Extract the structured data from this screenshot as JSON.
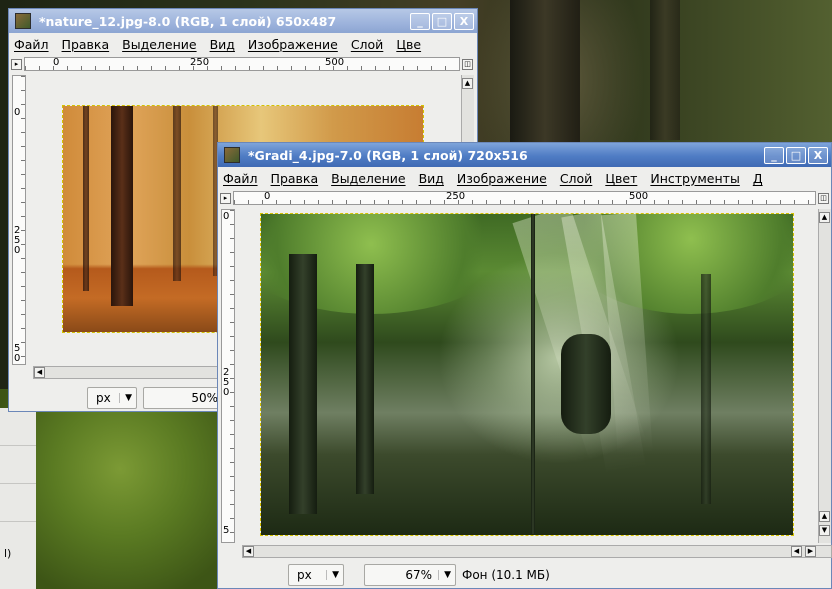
{
  "window_back": {
    "title": "*nature_12.jpg-8.0 (RGB, 1 слой) 650x487",
    "menu": [
      "Файл",
      "Правка",
      "Выделение",
      "Вид",
      "Изображение",
      "Слой",
      "Цве"
    ],
    "ruler_h": [
      "0",
      "250",
      "500"
    ],
    "ruler_v": [
      "0",
      "250",
      "50"
    ],
    "unit": "px",
    "zoom": "50%"
  },
  "window_front": {
    "title": "*Gradi_4.jpg-7.0 (RGB, 1 слой) 720x516",
    "menu": [
      "Файл",
      "Правка",
      "Выделение",
      "Вид",
      "Изображение",
      "Слой",
      "Цвет",
      "Инструменты",
      "Д"
    ],
    "ruler_h": [
      "0",
      "250",
      "500"
    ],
    "ruler_v": [
      "0",
      "250",
      "5"
    ],
    "unit": "px",
    "zoom": "67%",
    "status": "Фон (10.1 МБ)"
  },
  "side_panel_tail": "l)",
  "icons": {
    "minimize": "_",
    "maximize": "□",
    "close": "X"
  }
}
